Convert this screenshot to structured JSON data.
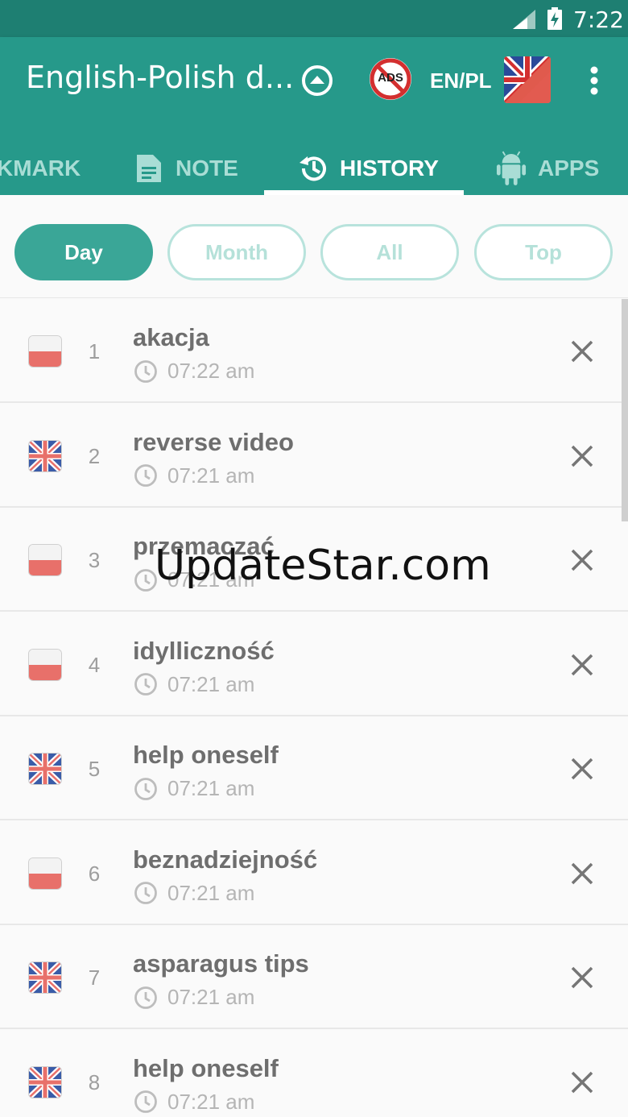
{
  "status_bar": {
    "time": "7:22"
  },
  "app_bar": {
    "title": "English-Polish d...",
    "lang_pair": "EN/PL",
    "no_ads_label": "ADS"
  },
  "tabs": [
    {
      "label": "KMARK"
    },
    {
      "label": "NOTE"
    },
    {
      "label": "HISTORY"
    },
    {
      "label": "APPS"
    }
  ],
  "filters": [
    {
      "label": "Day"
    },
    {
      "label": "Month"
    },
    {
      "label": "All"
    },
    {
      "label": "Top"
    }
  ],
  "history": [
    {
      "num": "1",
      "word": "akacja",
      "time": "07:22 am",
      "lang": "pl"
    },
    {
      "num": "2",
      "word": "reverse video",
      "time": "07:21 am",
      "lang": "en"
    },
    {
      "num": "3",
      "word": "przemaczać",
      "time": "07:21 am",
      "lang": "pl"
    },
    {
      "num": "4",
      "word": "idylliczność",
      "time": "07:21 am",
      "lang": "pl"
    },
    {
      "num": "5",
      "word": "help oneself",
      "time": "07:21 am",
      "lang": "en"
    },
    {
      "num": "6",
      "word": "beznadziejność",
      "time": "07:21 am",
      "lang": "pl"
    },
    {
      "num": "7",
      "word": "asparagus tips",
      "time": "07:21 am",
      "lang": "en"
    },
    {
      "num": "8",
      "word": "help oneself",
      "time": "07:21 am",
      "lang": "en"
    }
  ],
  "watermark": "UpdateStar.com",
  "colors": {
    "status": "#1e7f72",
    "primary": "#26998a",
    "chip_active": "#3aa697"
  }
}
